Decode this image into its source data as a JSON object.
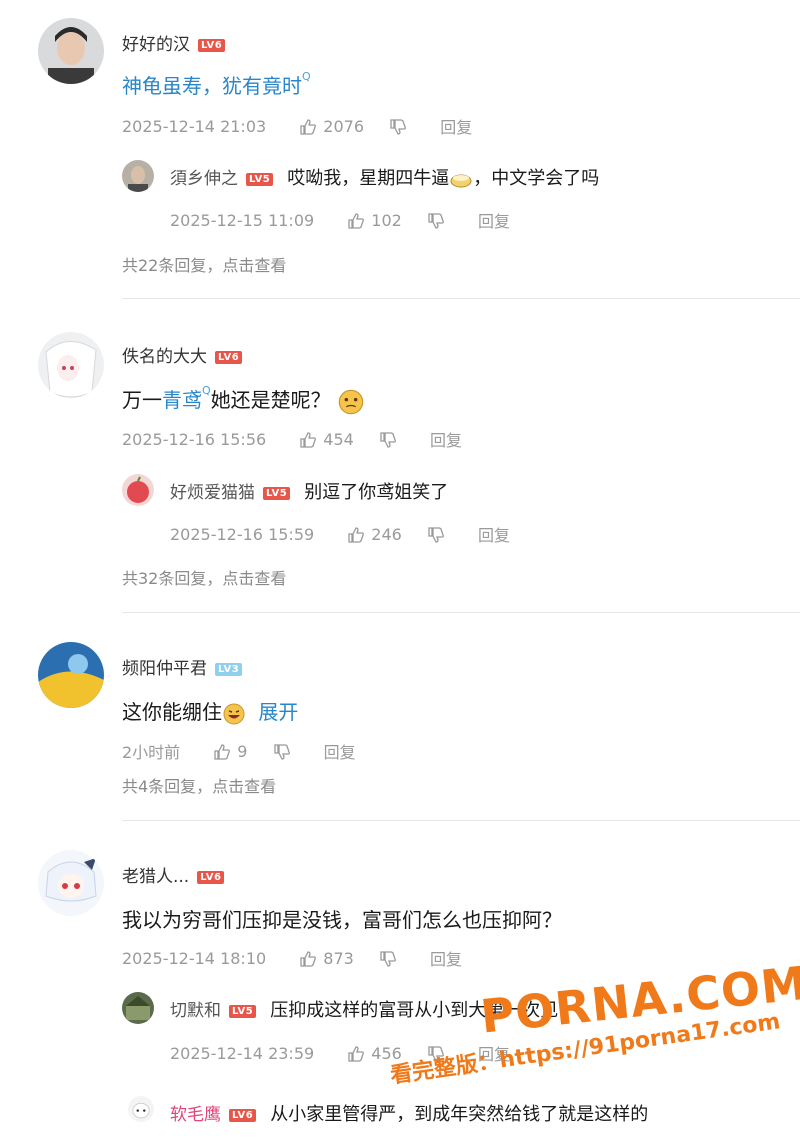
{
  "comments": [
    {
      "user": "好好的汉",
      "level": "LV6",
      "text_link": "神龟虽寿，犹有竟时",
      "search_mark": "Q",
      "time": "2025-12-14 21:03",
      "likes": "2076",
      "reply_label": "回复",
      "sub": {
        "user": "須乡伸之",
        "level": "LV5",
        "text": "哎呦我，星期四牛逼",
        "text_after": "，中文学会了吗",
        "time": "2025-12-15 11:09",
        "likes": "102",
        "reply_label": "回复"
      },
      "more": "共22条回复，点击查看"
    },
    {
      "user": "佚名的大大",
      "level": "LV6",
      "text_before": "万一",
      "text_link": "青鸢",
      "search_mark": "Q",
      "text_after": "她还是楚呢？",
      "time": "2025-12-16 15:56",
      "likes": "454",
      "reply_label": "回复",
      "sub": {
        "user": "好烦爱猫猫",
        "level": "LV5",
        "text": "别逗了你鸢姐笑了",
        "time": "2025-12-16 15:59",
        "likes": "246",
        "reply_label": "回复"
      },
      "more": "共32条回复，点击查看"
    },
    {
      "user": "频阳仲平君",
      "level": "LV3",
      "text": "这你能绷住",
      "expand": "展开",
      "time": "2小时前",
      "likes": "9",
      "reply_label": "回复",
      "more": "共4条回复，点击查看"
    },
    {
      "user": "老猎人...",
      "level": "LV6",
      "text": "我以为穷哥们压抑是没钱，富哥们怎么也压抑阿？",
      "time": "2025-12-14 18:10",
      "likes": "873",
      "reply_label": "回复",
      "sub": {
        "user": "切默和",
        "level": "LV5",
        "text": "压抑成这样的富哥从小到大第一次见",
        "time": "2025-12-14 23:59",
        "likes": "456",
        "reply_label": "回复"
      },
      "sub2": {
        "user": "软毛鹰",
        "level": "LV6",
        "text": "从小家里管得严，到成年突然给钱了就是这样的"
      }
    }
  ],
  "watermark": {
    "logo": "PORNA.COM",
    "url": "看完整版：https://91porna17.com"
  },
  "colors": {
    "link": "#2a86c8",
    "level_red": "#e8564a",
    "level_blue": "#8fd0ee",
    "meta": "#9a9a9a",
    "watermark": "#f07a1a"
  }
}
